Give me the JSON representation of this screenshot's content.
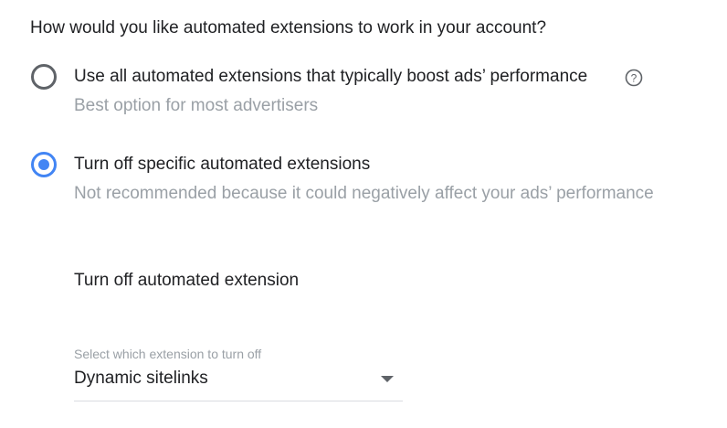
{
  "question": "How would you like automated extensions to work in your account?",
  "options": [
    {
      "label": "Use all automated extensions that typically boost ads’ performance",
      "sublabel": "Best option for most advertisers",
      "selected": false,
      "has_help_icon": true
    },
    {
      "label": "Turn off specific automated extensions",
      "sublabel": "Not recommended because it could negatively affect your ads’ performance",
      "selected": true,
      "has_help_icon": false
    }
  ],
  "section": {
    "title": "Turn off automated extension"
  },
  "select": {
    "label": "Select which extension to turn off",
    "value": "Dynamic sitelinks"
  },
  "colors": {
    "accent": "#4285f4",
    "radio_unchecked": "#5f6368",
    "text_primary": "#202124",
    "text_secondary": "#9aa0a6",
    "divider": "#dadce0"
  },
  "icons": {
    "help": "help-circle-icon",
    "dropdown": "arrow-drop-down-icon"
  }
}
